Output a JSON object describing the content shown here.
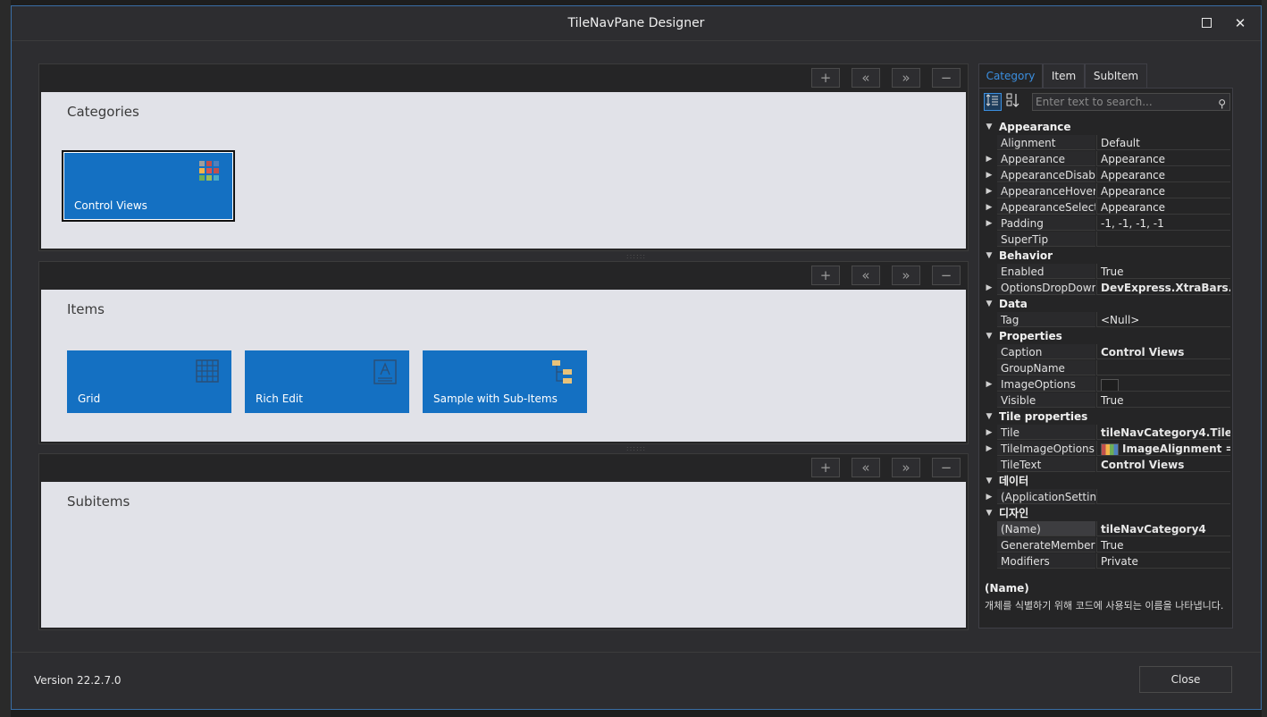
{
  "window": {
    "title": "TileNavPane Designer",
    "maximize_icon": "maximize-icon",
    "close_glyph": "✕"
  },
  "toolbar_buttons": {
    "add": "+",
    "move_left": "«",
    "move_right": "»",
    "remove": "−"
  },
  "sections": {
    "categories": {
      "title": "Categories",
      "tiles": [
        {
          "label": "Control Views",
          "icon": "palette-grid-icon",
          "selected": true
        }
      ]
    },
    "items": {
      "title": "Items",
      "tiles": [
        {
          "label": "Grid",
          "icon": "grid-icon"
        },
        {
          "label": "Rich Edit",
          "icon": "rich-edit-icon"
        },
        {
          "label": "Sample with Sub-Items",
          "icon": "hierarchy-icon"
        }
      ]
    },
    "subitems": {
      "title": "Subitems",
      "tiles": []
    }
  },
  "property_panel": {
    "tabs": [
      {
        "label": "Category",
        "active": true
      },
      {
        "label": "Item",
        "active": false
      },
      {
        "label": "SubItem",
        "active": false
      }
    ],
    "search_placeholder": "Enter text to search...",
    "rows": [
      {
        "type": "cat",
        "name": "Appearance"
      },
      {
        "type": "prop",
        "name": "Alignment",
        "value": "Default"
      },
      {
        "type": "prop",
        "name": "Appearance",
        "value": "Appearance",
        "expandable": true
      },
      {
        "type": "prop",
        "name": "AppearanceDisabled",
        "value": "Appearance",
        "expandable": true
      },
      {
        "type": "prop",
        "name": "AppearanceHovered",
        "value": "Appearance",
        "expandable": true
      },
      {
        "type": "prop",
        "name": "AppearanceSelected",
        "value": "Appearance",
        "expandable": true
      },
      {
        "type": "prop",
        "name": "Padding",
        "value": "-1, -1, -1, -1",
        "expandable": true
      },
      {
        "type": "prop",
        "name": "SuperTip",
        "value": ""
      },
      {
        "type": "cat",
        "name": "Behavior"
      },
      {
        "type": "prop",
        "name": "Enabled",
        "value": "True"
      },
      {
        "type": "prop",
        "name": "OptionsDropDown",
        "value": "DevExpress.XtraBars.Nav",
        "expandable": true,
        "bold": true
      },
      {
        "type": "cat",
        "name": "Data"
      },
      {
        "type": "prop",
        "name": "Tag",
        "value": "<Null>"
      },
      {
        "type": "cat",
        "name": "Properties"
      },
      {
        "type": "prop",
        "name": "Caption",
        "value": "Control Views",
        "bold": true
      },
      {
        "type": "prop",
        "name": "GroupName",
        "value": ""
      },
      {
        "type": "prop",
        "name": "ImageOptions",
        "value": "",
        "expandable": true,
        "swatch": "#1e1e1e"
      },
      {
        "type": "prop",
        "name": "Visible",
        "value": "True"
      },
      {
        "type": "cat",
        "name": "Tile properties"
      },
      {
        "type": "prop",
        "name": "Tile",
        "value": "tileNavCategory4.Tile",
        "expandable": true,
        "bold": true
      },
      {
        "type": "prop",
        "name": "TileImageOptions",
        "value": "ImageAlignment =",
        "expandable": true,
        "bold": true,
        "swatch": "multicolor"
      },
      {
        "type": "prop",
        "name": "TileText",
        "value": "Control Views",
        "bold": true
      },
      {
        "type": "cat",
        "name": "데이터"
      },
      {
        "type": "prop",
        "name": "(ApplicationSettings)",
        "value": "",
        "expandable": true
      },
      {
        "type": "cat",
        "name": "디자인"
      },
      {
        "type": "prop",
        "name": "(Name)",
        "value": "tileNavCategory4",
        "bold": true,
        "selected": true
      },
      {
        "type": "prop",
        "name": "GenerateMember",
        "value": "True"
      },
      {
        "type": "prop",
        "name": "Modifiers",
        "value": "Private"
      }
    ],
    "description": {
      "title": "(Name)",
      "text": "개체를 식별하기 위해 코드에 사용되는 이름을 나타냅니다."
    }
  },
  "footer": {
    "version": "Version 22.2.7.0",
    "close_label": "Close"
  },
  "colors": {
    "tile_blue": "#1470c2",
    "accent": "#3b8fe0",
    "panel_bg": "#e1e2e8"
  }
}
